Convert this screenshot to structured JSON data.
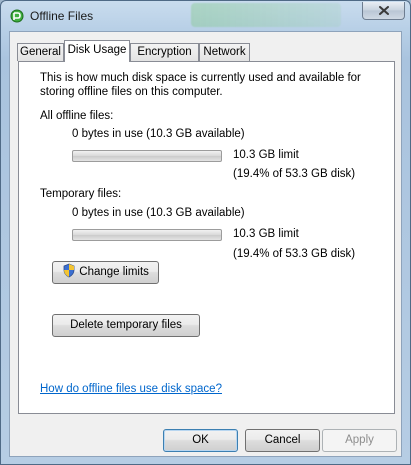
{
  "window": {
    "title": "Offline Files"
  },
  "tabs": [
    {
      "label": "General"
    },
    {
      "label": "Disk Usage",
      "active": true
    },
    {
      "label": "Encryption"
    },
    {
      "label": "Network"
    }
  ],
  "disk_usage": {
    "description": "This is how much disk space is currently used and available for storing offline files on this computer.",
    "all_offline": {
      "heading": "All offline files:",
      "usage": "0 bytes in use (10.3 GB available)",
      "used_fraction": 0,
      "limit": "10.3 GB limit",
      "percent": "(19.4% of 53.3 GB disk)"
    },
    "temporary": {
      "heading": "Temporary files:",
      "usage": "0 bytes in use (10.3 GB available)",
      "used_fraction": 0,
      "limit": "10.3 GB limit",
      "percent": "(19.4% of 53.3 GB disk)"
    },
    "change_limits_label": "Change limits",
    "delete_temp_label": "Delete temporary files",
    "help_link": "How do offline files use disk space?"
  },
  "footer": {
    "ok": "OK",
    "cancel": "Cancel",
    "apply": "Apply"
  },
  "colors": {
    "link": "#0066cc",
    "progress_fill": "#06b025"
  },
  "icons": {
    "app": "offline-files-icon",
    "close": "close-icon",
    "shield": "uac-shield-icon"
  }
}
